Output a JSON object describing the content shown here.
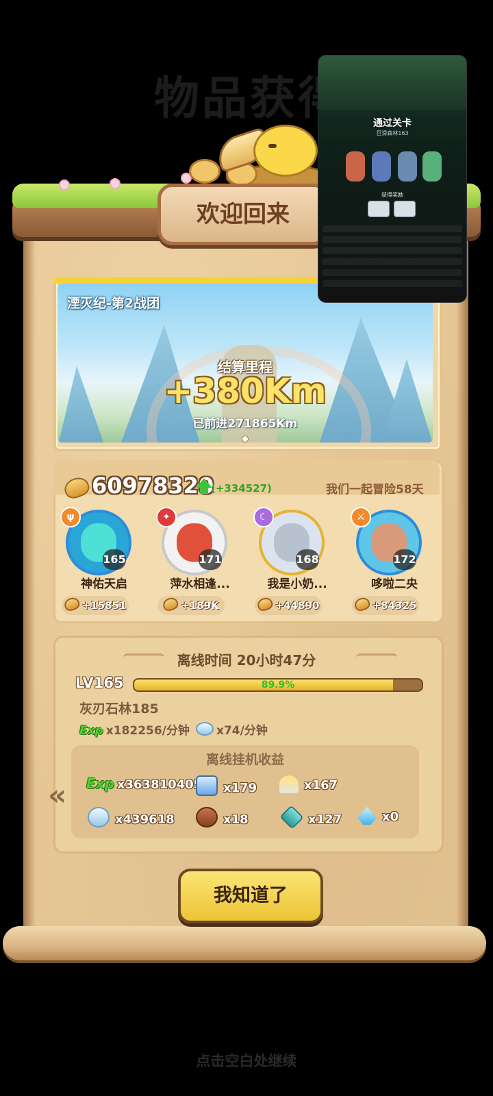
{
  "background": {
    "title": "物品获得",
    "continue_hint": "点击空白处继续"
  },
  "banner": {
    "title": "欢迎回来"
  },
  "journey": {
    "team_name": "湮灭纪-第2战团",
    "label": "结算里程",
    "distance": "+380Km",
    "total": "已前进271865Km"
  },
  "power": {
    "value": "60978320",
    "delta": "(+334527)",
    "days": "我们一起冒险58天"
  },
  "heroes": [
    {
      "name": "神佑天启",
      "level": "165",
      "gain": "+15851",
      "badge_icon": "trident-icon"
    },
    {
      "name": "萍水相逢...",
      "level": "171",
      "gain": "+189K",
      "badge_icon": "fire-icon"
    },
    {
      "name": "我是小奶...",
      "level": "168",
      "gain": "+44890",
      "badge_icon": "moon-icon"
    },
    {
      "name": "哆啦二央",
      "level": "172",
      "gain": "+84325",
      "badge_icon": "sword-icon"
    }
  ],
  "offline": {
    "title": "离线时间 20小时47分",
    "level": "LV165",
    "progress_pct": "89.9%",
    "progress_fraction": 0.899,
    "stage": "灰刃石林185",
    "exp_tag": "Exp",
    "exp_rate": "x182256/分钟",
    "shell_rate": "x74/分钟",
    "gains_title": "离线挂机收益",
    "items": [
      {
        "icon": "exp-icon",
        "text": "x363810405"
      },
      {
        "icon": "gift-box-icon",
        "text": "x179"
      },
      {
        "icon": "torch-icon",
        "text": "x167"
      },
      {
        "icon": "shell-icon",
        "text": "x439618"
      },
      {
        "icon": "meat-icon",
        "text": "x18"
      },
      {
        "icon": "gem-icon",
        "text": "x127"
      },
      {
        "icon": "crystal-icon",
        "text": "x0"
      }
    ]
  },
  "confirm_button": {
    "label": "我知道了"
  },
  "pip_overlay": {
    "title": "通过关卡",
    "subtitle": "巨滑森林163",
    "reward_label": "获得奖励"
  },
  "colors": {
    "parchment": "#e5c594",
    "button": "#edc434",
    "mileage": "#fbe26a",
    "power_up": "#3ec43a"
  }
}
